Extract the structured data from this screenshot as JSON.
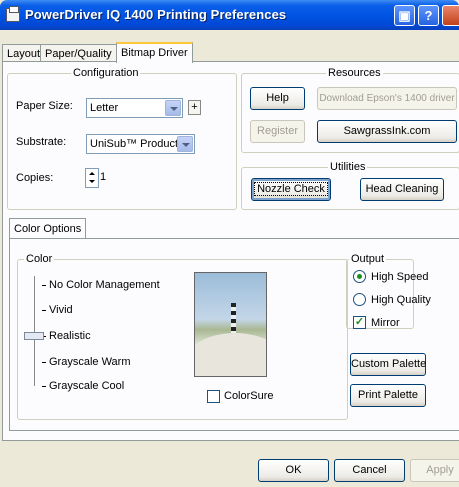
{
  "window": {
    "title": "PowerDriver IQ 1400 Printing Preferences"
  },
  "tabs": [
    "Layout",
    "Paper/Quality",
    "Bitmap Driver"
  ],
  "configuration": {
    "legend": "Configuration",
    "paper_size_label": "Paper Size:",
    "paper_size_value": "Letter",
    "plus_label": "+",
    "substrate_label": "Substrate:",
    "substrate_value": "UniSub™ Products",
    "copies_label": "Copies:",
    "copies_value": "1"
  },
  "resources": {
    "legend": "Resources",
    "help": "Help",
    "download": "Download Epson's 1400 driver",
    "register": "Register",
    "sawgrass": "SawgrassInk.com"
  },
  "utilities": {
    "legend": "Utilities",
    "nozzle": "Nozzle Check",
    "head": "Head Cleaning"
  },
  "color_options": {
    "tab": "Color Options",
    "color_legend": "Color",
    "levels": [
      "No Color Management",
      "Vivid",
      "Realistic",
      "Grayscale Warm",
      "Grayscale Cool"
    ],
    "selected_level": "Realistic",
    "colorsure_label": "ColorSure",
    "colorsure_checked": false,
    "output_legend": "Output",
    "high_speed": "High Speed",
    "high_quality": "High Quality",
    "output_selected": "High Speed",
    "mirror": "Mirror",
    "mirror_checked": true,
    "custom_palette": "Custom Palette",
    "print_palette": "Print Palette"
  },
  "footer": {
    "ok": "OK",
    "cancel": "Cancel",
    "apply": "Apply"
  },
  "icons": {
    "window": "printer-icon",
    "minimize": "minimize-icon",
    "help": "help-icon",
    "close": "close-icon"
  },
  "colors": {
    "titlebar": "#0054e3",
    "face": "#ece9d8",
    "panel": "#fcfcfe",
    "active_tab_highlight": "#ffc83c"
  }
}
